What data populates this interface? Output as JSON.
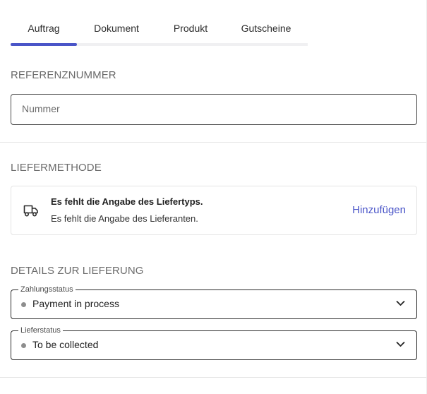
{
  "tabs": [
    {
      "label": "Auftrag",
      "active": true
    },
    {
      "label": "Dokument",
      "active": false
    },
    {
      "label": "Produkt",
      "active": false
    },
    {
      "label": "Gutscheine",
      "active": false
    }
  ],
  "reference": {
    "title": "REFERENZNUMMER",
    "placeholder": "Nummer",
    "value": ""
  },
  "delivery_method": {
    "title": "LIEFERMETHODE",
    "icon": "truck-icon",
    "line1": "Es fehlt die Angabe des Liefertyps.",
    "line2": "Es fehlt die Angabe des Lieferanten.",
    "action_label": "Hinzufügen"
  },
  "delivery_details": {
    "title": "DETAILS ZUR LIEFERUNG",
    "payment_status": {
      "label": "Zahlungsstatus",
      "value": "Payment in process"
    },
    "delivery_status": {
      "label": "Lieferstatus",
      "value": "To be collected"
    }
  },
  "colors": {
    "accent": "#4a55c8",
    "status_dot": "#8e8e8e"
  }
}
